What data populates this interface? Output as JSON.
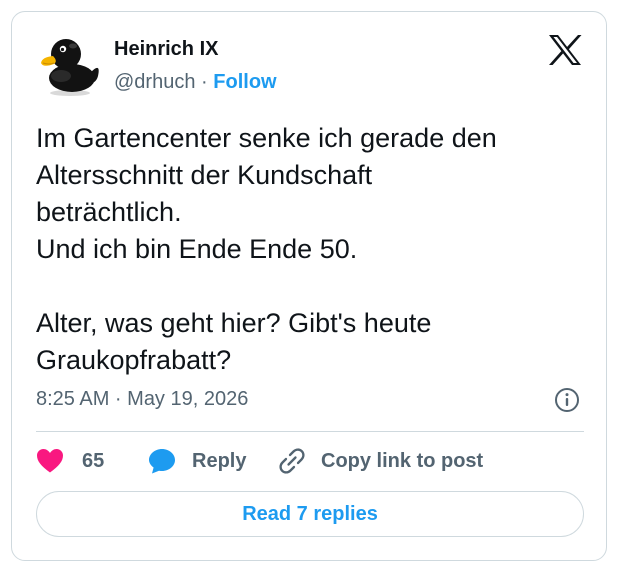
{
  "author": {
    "name": "Heinrich IX",
    "handle": "@drhuch",
    "separator": "·",
    "follow_label": "Follow",
    "avatar_icon": "rubber-duck-avatar"
  },
  "platform_icon": "x-logo-icon",
  "tweet": {
    "text": "Im Gartencenter senke ich gerade den\nAltersschnitt der Kundschaft\nbeträchtlich.\nUnd ich bin Ende Ende 50.\n\nAlter, was geht hier? Gibt's heute\nGraukopfrabatt?",
    "timestamp": "8:25 AM · May 19, 2026"
  },
  "actions": {
    "like_count": "65",
    "reply_label": "Reply",
    "copy_label": "Copy link to post",
    "read_replies_label": "Read 7 replies"
  },
  "colors": {
    "like": "#f91880",
    "reply": "#1d9bf0",
    "link": "#1d9bf0",
    "muted": "#536471",
    "text": "#0f1419",
    "border": "#cfd9de"
  }
}
